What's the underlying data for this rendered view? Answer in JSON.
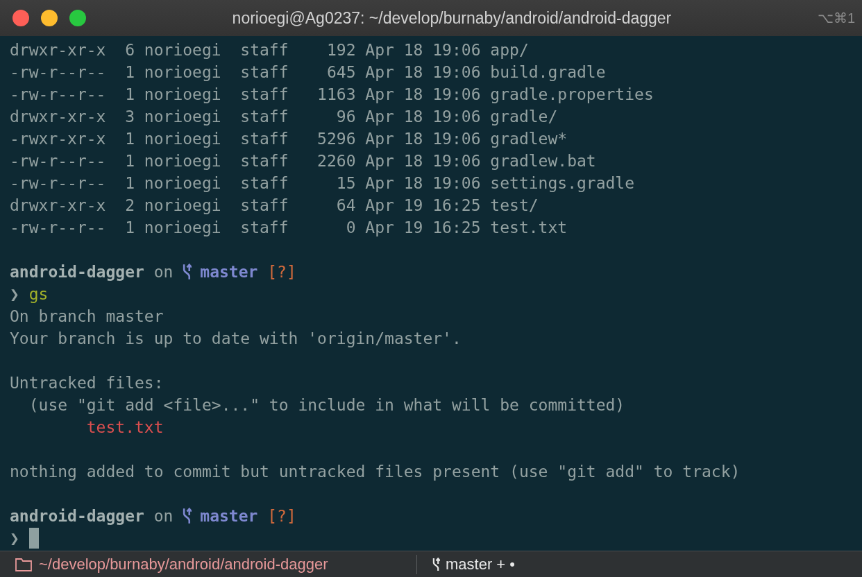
{
  "window": {
    "title": "norioegi@Ag0237: ~/develop/burnaby/android/android-dagger",
    "shortcut": "⌥⌘1"
  },
  "lines": [
    {
      "kind": "output",
      "text": "drwxr-xr-x  6 norioegi  staff    192 Apr 18 19:06 app/"
    },
    {
      "kind": "output",
      "text": "-rw-r--r--  1 norioegi  staff    645 Apr 18 19:06 build.gradle"
    },
    {
      "kind": "output",
      "text": "-rw-r--r--  1 norioegi  staff   1163 Apr 18 19:06 gradle.properties"
    },
    {
      "kind": "output",
      "text": "drwxr-xr-x  3 norioegi  staff     96 Apr 18 19:06 gradle/"
    },
    {
      "kind": "output",
      "text": "-rwxr-xr-x  1 norioegi  staff   5296 Apr 18 19:06 gradlew*"
    },
    {
      "kind": "output",
      "text": "-rw-r--r--  1 norioegi  staff   2260 Apr 18 19:06 gradlew.bat"
    },
    {
      "kind": "output",
      "text": "-rw-r--r--  1 norioegi  staff     15 Apr 18 19:06 settings.gradle"
    },
    {
      "kind": "output",
      "text": "drwxr-xr-x  2 norioegi  staff     64 Apr 19 16:25 test/"
    },
    {
      "kind": "output",
      "text": "-rw-r--r--  1 norioegi  staff      0 Apr 19 16:25 test.txt"
    },
    {
      "kind": "blank"
    },
    {
      "kind": "prompt",
      "dir": "android-dagger",
      "on": "on",
      "branch": "master",
      "status": "[?]"
    },
    {
      "kind": "command",
      "symbol": "❯",
      "text": "gs"
    },
    {
      "kind": "output",
      "text": "On branch master"
    },
    {
      "kind": "output",
      "text": "Your branch is up to date with 'origin/master'."
    },
    {
      "kind": "blank"
    },
    {
      "kind": "output",
      "text": "Untracked files:"
    },
    {
      "kind": "output",
      "text": "  (use \"git add <file>...\" to include in what will be committed)"
    },
    {
      "kind": "untracked",
      "text": "        test.txt"
    },
    {
      "kind": "blank"
    },
    {
      "kind": "output",
      "text": "nothing added to commit but untracked files present (use \"git add\" to track)"
    },
    {
      "kind": "blank"
    },
    {
      "kind": "prompt",
      "dir": "android-dagger",
      "on": "on",
      "branch": "master",
      "status": "[?]"
    },
    {
      "kind": "cursor",
      "symbol": "❯"
    }
  ],
  "status_bar": {
    "path": "~/develop/burnaby/android/android-dagger",
    "branch": "master + •"
  }
}
